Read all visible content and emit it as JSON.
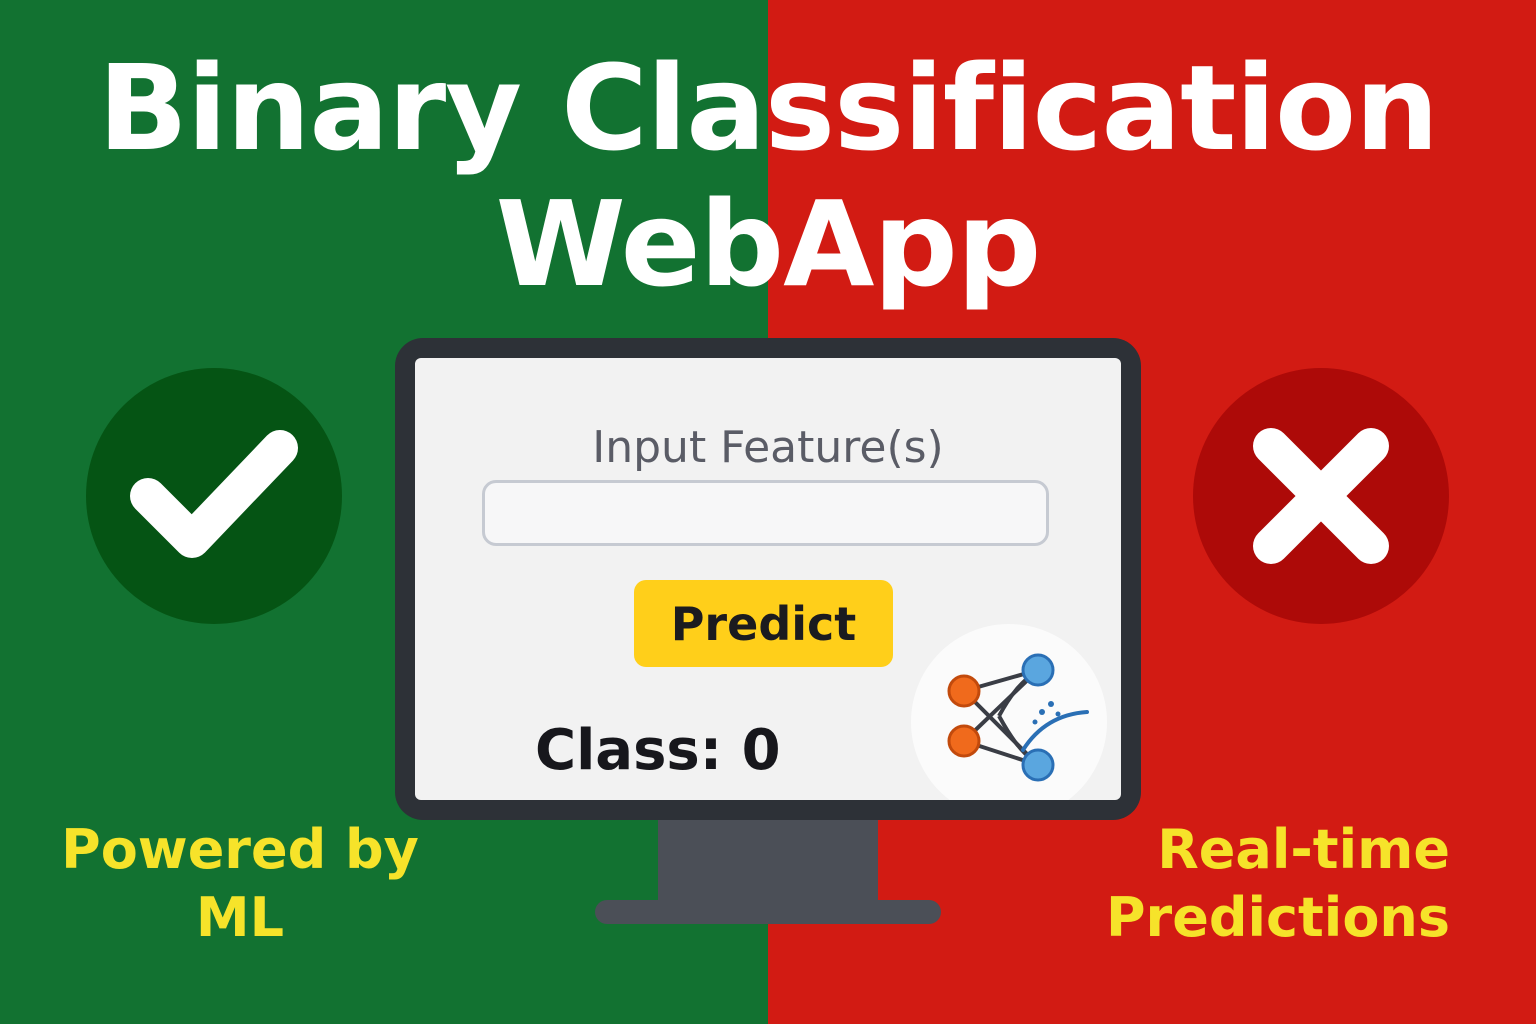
{
  "colors": {
    "left_bg": "#127231",
    "right_bg": "#d21b13",
    "check_circle": "#055414",
    "cross_circle": "#ad0a08",
    "caption": "#f6e32a",
    "predict_button": "#ffcf1a"
  },
  "title": {
    "line1": "Binary Classification",
    "line2": "WebApp"
  },
  "form": {
    "input_label": "Input Feature(s)",
    "input_value": "",
    "predict_label": "Predict",
    "result": "Class: 0"
  },
  "captions": {
    "left_line1": "Powered by",
    "left_line2": "ML",
    "right_line1": "Real-time",
    "right_line2": "Predictions"
  },
  "icons": {
    "left_badge": "checkmark-icon",
    "right_badge": "cross-icon",
    "logo": "neural-network-icon"
  }
}
